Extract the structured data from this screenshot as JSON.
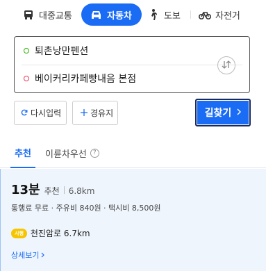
{
  "modes": {
    "transit": "대중교통",
    "car": "자동차",
    "walk": "도보",
    "bike": "자전거"
  },
  "route": {
    "origin": "퇴촌낭만펜션",
    "destination": "베이커리카페빵내음 본점"
  },
  "actions": {
    "reset": "다시입력",
    "via": "경유지",
    "search": "길찾기"
  },
  "tabs": {
    "recommended": "추천",
    "low_cost": "이륜차우선",
    "help": "?"
  },
  "result": {
    "time": "13분",
    "tag": "추천",
    "distance": "6.8km",
    "fees": "통행료 무료 · 주유비 840원 · 택시비 8,500원",
    "road_badge": "시행",
    "road": "천진암로 6.7km",
    "detail": "상세보기"
  },
  "colors": {
    "accent": "#1a6cf5",
    "origin_dot": "#2db400",
    "dest_dot": "#f1375c",
    "road_badge": "#f6c500"
  }
}
